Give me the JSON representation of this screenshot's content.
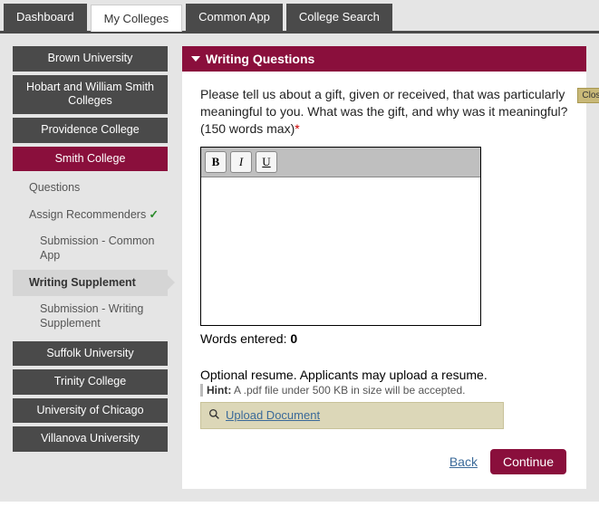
{
  "tabs": {
    "dashboard": "Dashboard",
    "mycolleges": "My Colleges",
    "commonapp": "Common App",
    "collegesearch": "College Search"
  },
  "colleges_top": [
    "Brown University",
    "Hobart and William Smith Colleges",
    "Providence College",
    "Smith College"
  ],
  "subnav": {
    "questions": "Questions",
    "assign": "Assign Recommenders",
    "sub_common": "Submission - Common App",
    "writing": "Writing Supplement",
    "sub_writing": "Submission - Writing Supplement"
  },
  "colleges_bottom": [
    "Suffolk University",
    "Trinity College",
    "University of Chicago",
    "Villanova University"
  ],
  "panel": {
    "title": "Writing Questions",
    "prompt": "Please tell us about a gift, given or received, that was particularly meaningful to you. What was the gift, and why was it meaningful? (150 words max)",
    "req": "*",
    "tb_bold": "B",
    "tb_italic": "I",
    "tb_under": "U",
    "words_label": "Words entered: ",
    "words_count": "0",
    "optional": "Optional resume. Applicants may upload a resume.",
    "hint_label": "Hint:",
    "hint_text": " A .pdf file under 500 KB in size will be accepted.",
    "upload": "Upload Document",
    "back": "Back",
    "continue": "Continue",
    "close": "Close"
  }
}
